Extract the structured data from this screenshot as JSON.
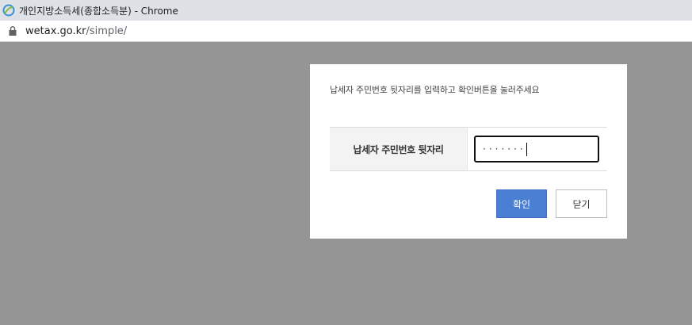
{
  "browser": {
    "window_title": "개인지방소득세(종합소득분) - Chrome",
    "url_domain": "wetax.go.kr",
    "url_path": "/simple/"
  },
  "modal": {
    "instruction": "납세자 주민번호 뒷자리를 입력하고 확인버튼을 눌러주세요",
    "field_label": "납세자 주민번호 뒷자리",
    "field_value_masked": "·······",
    "confirm_label": "확인",
    "close_label": "닫기"
  },
  "colors": {
    "overlay": "#959595",
    "confirm_button": "#4a7fd4",
    "label_background": "#f3f3f3"
  }
}
